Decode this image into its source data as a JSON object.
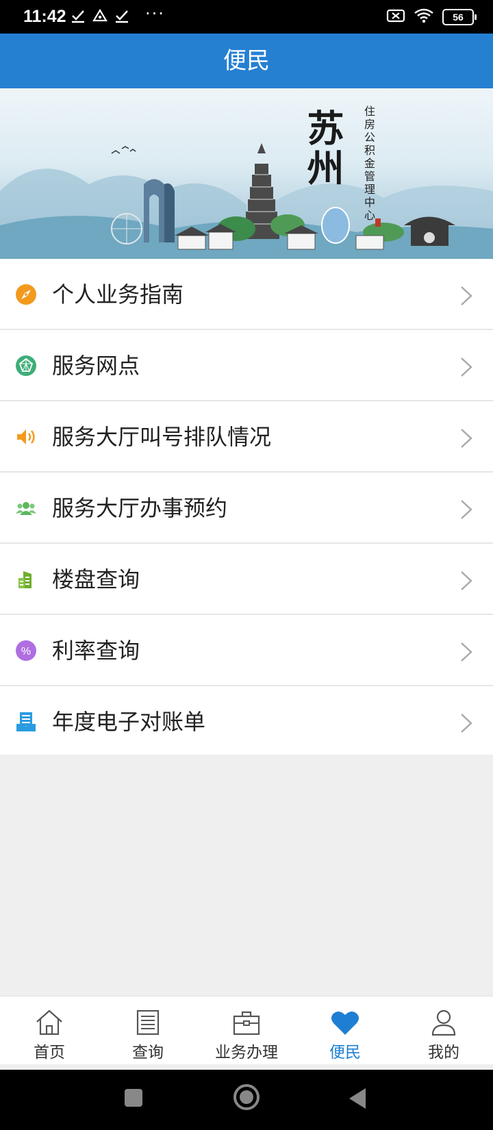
{
  "status_bar": {
    "time": "11:42",
    "dots": "···",
    "battery": "56",
    "icons": [
      "check-icon",
      "drive-icon",
      "check-icon",
      "no-sim-icon",
      "wifi-icon",
      "battery-icon"
    ]
  },
  "header": {
    "title": "便民"
  },
  "banner": {
    "city": "苏州",
    "org": "住房公积金管理中心"
  },
  "menu": {
    "items": [
      {
        "label": "个人业务指南",
        "icon": "compass-icon",
        "color": "#f39a1e"
      },
      {
        "label": "服务网点",
        "icon": "location-network-icon",
        "color": "#3fae79"
      },
      {
        "label": "服务大厅叫号排队情况",
        "icon": "speaker-icon",
        "color": "#f39a1e"
      },
      {
        "label": "服务大厅办事预约",
        "icon": "users-icon",
        "color": "#5cb85c"
      },
      {
        "label": "楼盘查询",
        "icon": "buildings-icon",
        "color": "#6fae2c"
      },
      {
        "label": "利率查询",
        "icon": "percent-icon",
        "color": "#b06fe0"
      },
      {
        "label": "年度电子对账单",
        "icon": "statement-icon",
        "color": "#2a9be0"
      }
    ]
  },
  "tabbar": {
    "tabs": [
      {
        "label": "首页",
        "icon": "home-icon"
      },
      {
        "label": "查询",
        "icon": "document-icon"
      },
      {
        "label": "业务办理",
        "icon": "briefcase-icon"
      },
      {
        "label": "便民",
        "icon": "heart-icon",
        "active": true
      },
      {
        "label": "我的",
        "icon": "person-icon"
      }
    ],
    "active_color": "#1e7fd2"
  }
}
